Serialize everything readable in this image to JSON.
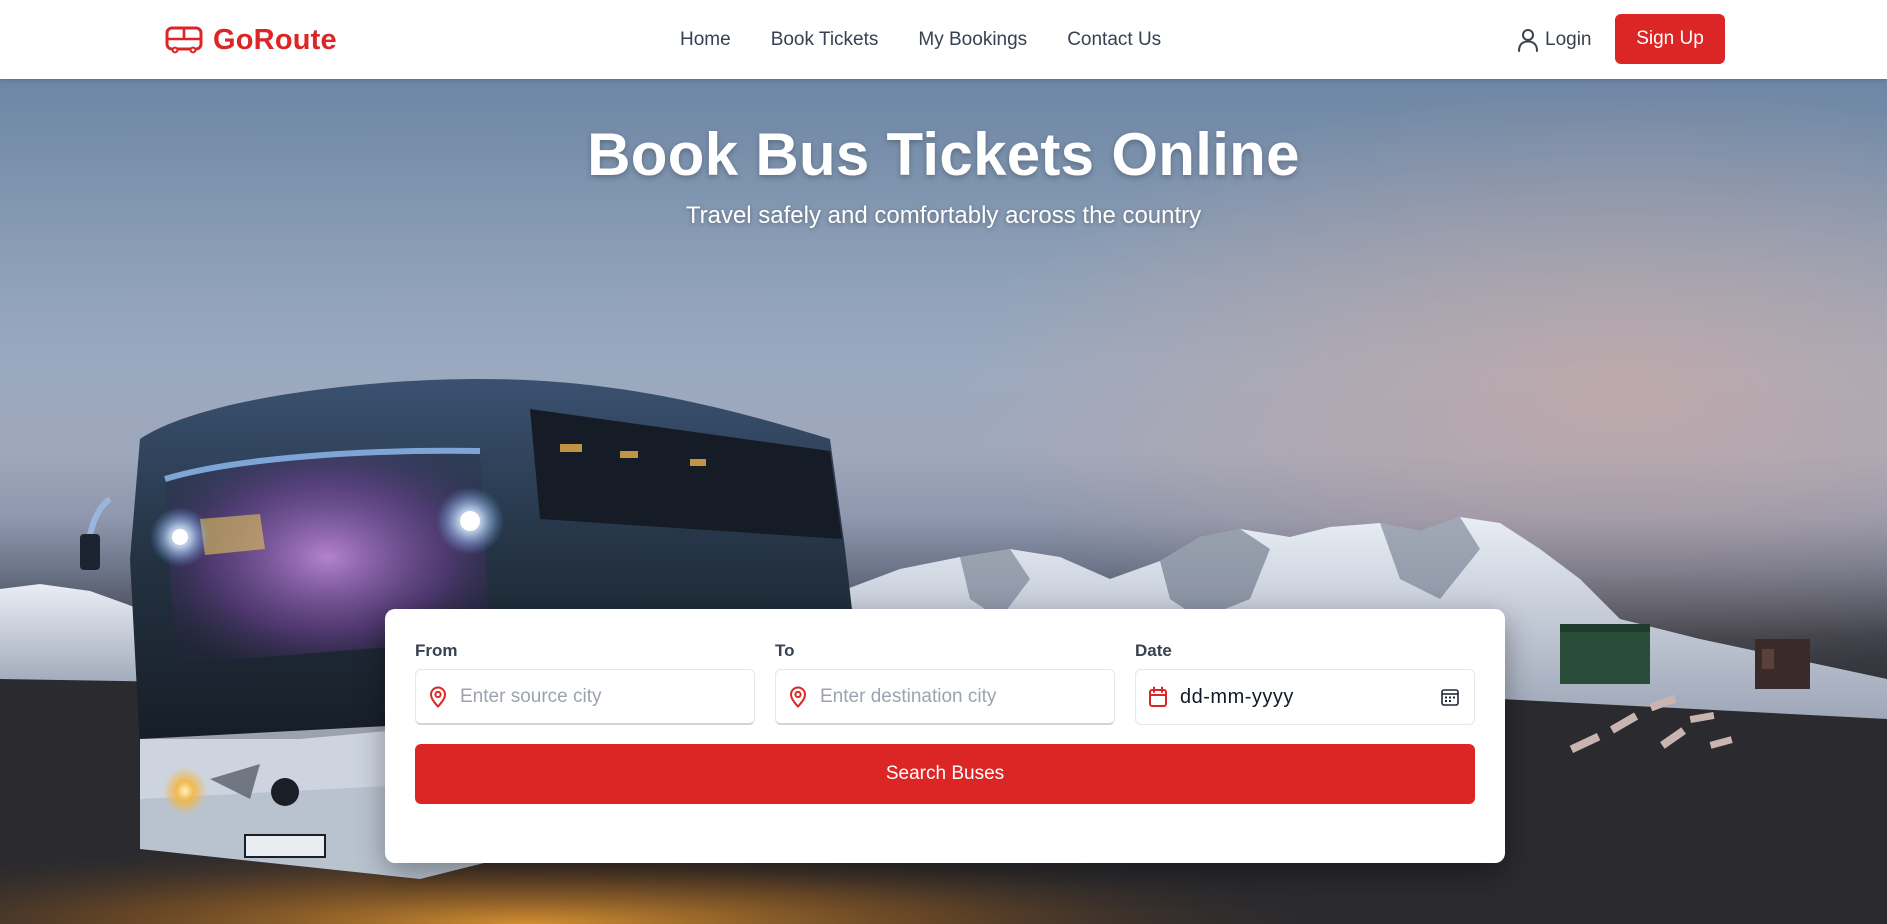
{
  "brand": {
    "name": "GoRoute",
    "icon": "bus-icon",
    "color": "#dc2626"
  },
  "nav": {
    "links": [
      "Home",
      "Book Tickets",
      "My Bookings",
      "Contact Us"
    ],
    "login_label": "Login",
    "login_icon": "user-icon",
    "signup_label": "Sign Up"
  },
  "hero": {
    "title": "Book Bus Tickets Online",
    "subtitle": "Travel safely and comfortably across the country",
    "background": "photo of a bus at dusk with snowy mountains"
  },
  "search": {
    "from_label": "From",
    "from_placeholder": "Enter source city",
    "from_icon": "map-pin-icon",
    "to_label": "To",
    "to_placeholder": "Enter destination city",
    "to_icon": "map-pin-icon",
    "date_label": "Date",
    "date_value": "dd-mm-yyyy",
    "date_icon": "calendar-icon",
    "date_picker_icon": "calendar-picker-icon",
    "button_label": "Search Buses",
    "accent": "#dc2626"
  }
}
